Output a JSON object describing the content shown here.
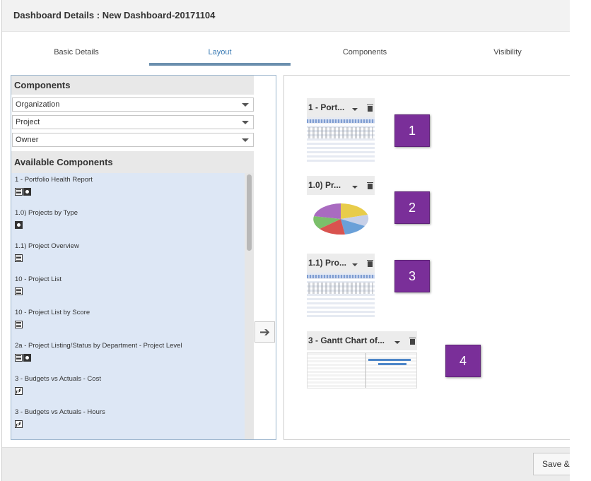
{
  "dialog": {
    "title": "Dashboard Details : New Dashboard-20171104"
  },
  "tabs": [
    {
      "label": "Basic Details",
      "active": false
    },
    {
      "label": "Layout",
      "active": true
    },
    {
      "label": "Components",
      "active": false
    },
    {
      "label": "Visibility",
      "active": false
    }
  ],
  "components_panel": {
    "header": "Components",
    "dropdowns": [
      {
        "value": "Organization"
      },
      {
        "value": "Project"
      },
      {
        "value": "Owner"
      }
    ],
    "available_header": "Available Components",
    "available": [
      {
        "label": "1 - Portfolio Health Report",
        "icons": [
          "table-icon",
          "pie-chart-icon"
        ]
      },
      {
        "label": "1.0) Projects by Type",
        "icons": [
          "pie-chart-icon"
        ]
      },
      {
        "label": "1.1) Project Overview",
        "icons": [
          "table-icon"
        ]
      },
      {
        "label": "10 - Project List",
        "icons": [
          "table-icon"
        ]
      },
      {
        "label": "10 - Project List by Score",
        "icons": [
          "table-icon"
        ]
      },
      {
        "label": "2a - Project Listing/Status by Department - Project Level",
        "icons": [
          "table-icon",
          "pie-chart-icon"
        ]
      },
      {
        "label": "3 - Budgets vs Actuals - Cost",
        "icons": [
          "bar-chart-icon"
        ]
      },
      {
        "label": "3 - Budgets vs Actuals - Hours",
        "icons": [
          "bar-chart-icon"
        ]
      }
    ]
  },
  "layout_widgets": [
    {
      "title": "1 - Port...",
      "thumbnail": "table",
      "number": "1"
    },
    {
      "title": "1.0) Pr...",
      "thumbnail": "pie",
      "number": "2"
    },
    {
      "title": "1.1) Pro...",
      "thumbnail": "table",
      "number": "3"
    },
    {
      "title": "3 - Gantt Chart of...",
      "thumbnail": "gantt",
      "number": "4"
    }
  ],
  "footer": {
    "save_label": "Save & "
  },
  "colors": {
    "accent": "#3b7bb4",
    "tab_underline": "#6b8fae",
    "list_bg": "#dde7f5",
    "number_box": "#7a2f99"
  }
}
